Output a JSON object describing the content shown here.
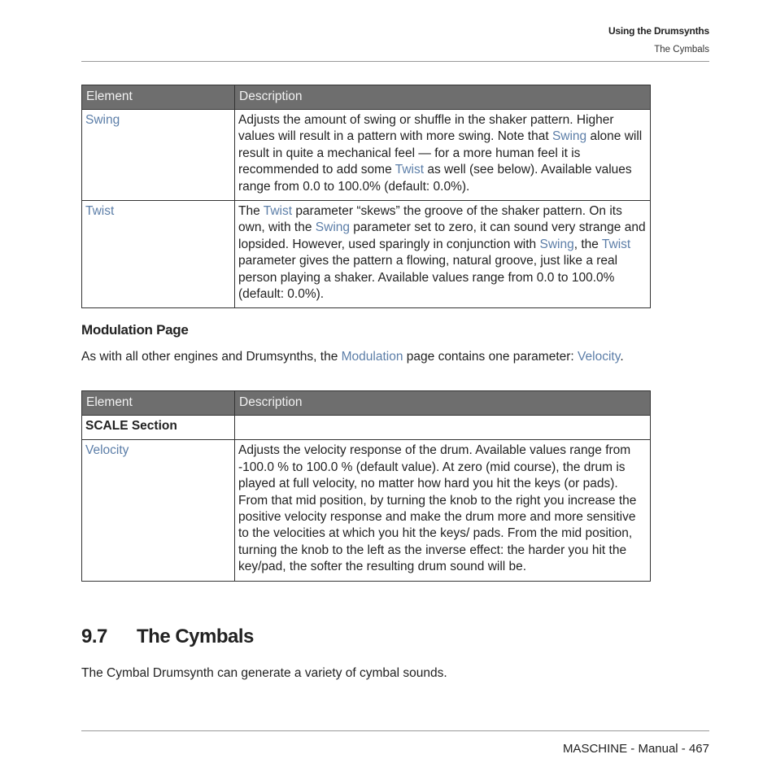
{
  "header": {
    "chapter": "Using the Drumsynths",
    "section": "The Cymbals"
  },
  "colors": {
    "link": "#5c7ea8",
    "table_header_bg": "#6e6e6e",
    "rule": "#999999"
  },
  "table1": {
    "headers": [
      "Element",
      "Description"
    ],
    "rows": [
      {
        "element": "Swing",
        "desc": [
          {
            "t": "Adjusts the amount of swing or shuffle in the shaker pattern. Higher values will result in a pattern with more swing. Note that "
          },
          {
            "t": "Swing",
            "link": true
          },
          {
            "t": " alone will result in quite a mechanical feel — for a more human feel it is recommended to add some "
          },
          {
            "t": "Twist",
            "link": true
          },
          {
            "t": " as well (see below). Available values range from 0.0 to 100.0% (default: 0.0%)."
          }
        ]
      },
      {
        "element": "Twist",
        "desc": [
          {
            "t": "The "
          },
          {
            "t": "Twist",
            "link": true
          },
          {
            "t": " parameter “skews” the groove of the shaker pattern. On its own, with the "
          },
          {
            "t": "Swing",
            "link": true
          },
          {
            "t": " parameter set to zero, it can sound very strange and lopsided. However, used sparingly in conjunction with "
          },
          {
            "t": "Swing",
            "link": true
          },
          {
            "t": ", the "
          },
          {
            "t": "Twist",
            "link": true
          },
          {
            "t": " parameter gives the pattern a flowing, natural groove, just like a real person playing a shaker. Available values range from 0.0 to 100.0% (default: 0.0%)."
          }
        ]
      }
    ]
  },
  "modulation": {
    "heading": "Modulation Page",
    "intro": [
      {
        "t": "As with all other engines and Drumsynths, the "
      },
      {
        "t": "Modulation",
        "link": true
      },
      {
        "t": " page contains one parameter: "
      },
      {
        "t": "Veloc­ity",
        "link": true
      },
      {
        "t": "."
      }
    ]
  },
  "table2": {
    "headers": [
      "Element",
      "Description"
    ],
    "section_row": "SCALE Section",
    "rows": [
      {
        "element": "Velocity",
        "desc": [
          {
            "t": "Adjusts the velocity response of the drum. Available values range from -100.0 % to 100.0 % (default value). At zero (mid course), the drum is played at full velocity, no matter how hard you hit the keys (or pads). From that mid position, by turning the knob to the right you increase the positive velocity response and make the drum more and more sensitive to the velocities at which you hit the keys/ pads. From the mid position, turning the knob to the left as the inverse effect: the harder you hit the key/pad, the softer the resulting drum sound will be."
          }
        ]
      }
    ]
  },
  "section": {
    "number": "9.7",
    "title": "The Cymbals",
    "body": "The Cymbal Drumsynth can generate a variety of cymbal sounds."
  },
  "footer": {
    "text": "MASCHINE - Manual - 467"
  }
}
